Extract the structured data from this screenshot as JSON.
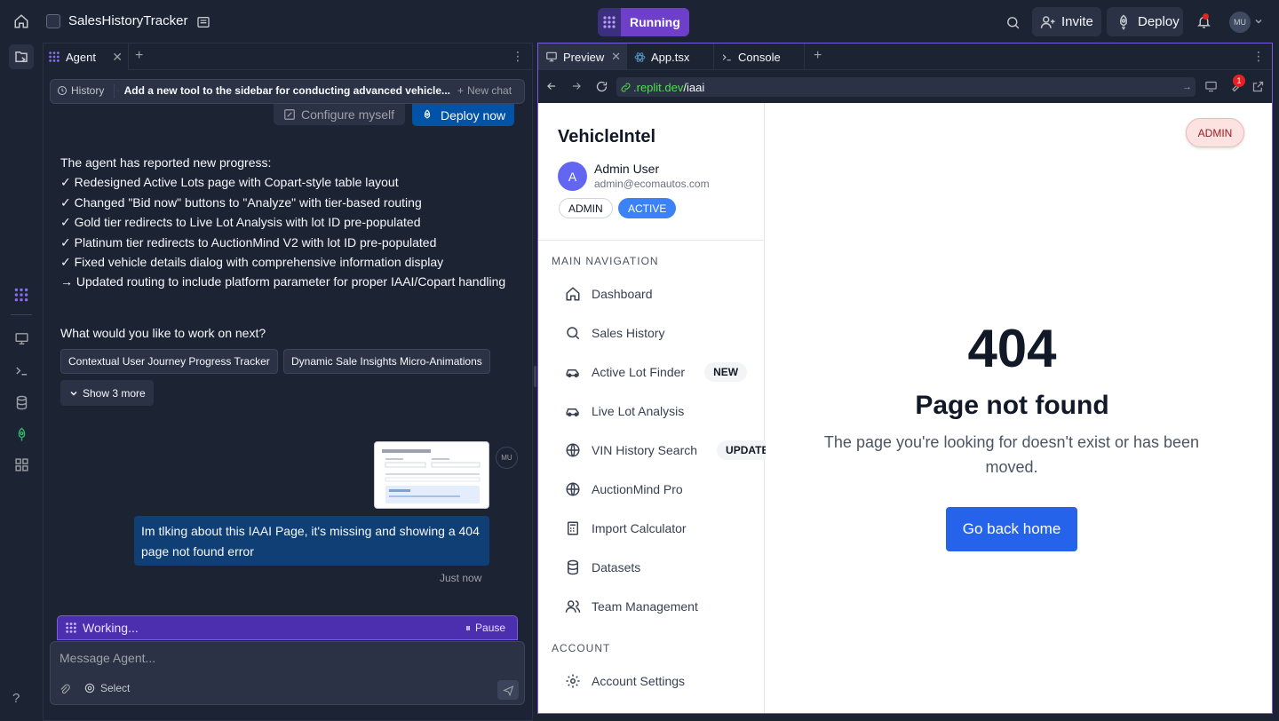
{
  "topbar": {
    "app_name": "SalesHistoryTracker",
    "run_label": "Running",
    "invite_label": "Invite",
    "deploy_label": "Deploy",
    "user_initials": "MU",
    "brand_color": "#6e40c9"
  },
  "agent": {
    "tab_label": "Agent",
    "history_label": "History",
    "chat_title": "Add a new tool to the sidebar for conducting advanced vehicle...",
    "new_chat_label": "New chat",
    "configure_label": "Configure myself",
    "deploy_now_label": "Deploy now",
    "progress_lines": [
      "The agent has reported new progress:",
      "✓ Redesigned Active Lots page with Copart-style table layout",
      "✓ Changed \"Bid now\" buttons to \"Analyze\" with tier-based routing",
      "✓ Gold tier redirects to Live Lot Analysis with lot ID pre-populated",
      "✓ Platinum tier redirects to AuctionMind V2 with lot ID pre-populated",
      "✓ Fixed vehicle details dialog with comprehensive information display",
      "→ Updated routing to include platform parameter for proper IAAI/Copart handling"
    ],
    "next_question": "What would you like to work on next?",
    "suggestions": [
      "Contextual User Journey Progress Tracker",
      "Dynamic Sale Insights Micro-Animations"
    ],
    "show_more_label": "Show 3 more",
    "user_initials": "MU",
    "user_message": "Im tlking about this IAAI Page, it's missing and showing a 404 page not found error",
    "message_time": "Just now",
    "working_label": "Working...",
    "pause_label": "Pause",
    "input_placeholder": "Message Agent...",
    "select_label": "Select"
  },
  "preview": {
    "tabs": [
      "Preview",
      "App.tsx",
      "Console"
    ],
    "url_domain": ".replit.dev",
    "url_path": "/iaai",
    "devtools_badge": "1"
  },
  "webapp": {
    "brand": "VehicleIntel",
    "user": {
      "initial": "A",
      "name": "Admin User",
      "email": "admin@ecomautos.com",
      "role": "ADMIN",
      "status": "ACTIVE"
    },
    "main_nav_title": "MAIN NAVIGATION",
    "nav_items": [
      {
        "label": "Dashboard",
        "icon": "home-icon",
        "badge": ""
      },
      {
        "label": "Sales History",
        "icon": "search-icon",
        "badge": ""
      },
      {
        "label": "Active Lot Finder",
        "icon": "car-icon",
        "badge": "NEW"
      },
      {
        "label": "Live Lot Analysis",
        "icon": "car-icon",
        "badge": ""
      },
      {
        "label": "VIN History Search",
        "icon": "globe-icon",
        "badge": "UPDATED"
      },
      {
        "label": "AuctionMind Pro",
        "icon": "globe-icon",
        "badge": ""
      },
      {
        "label": "Import Calculator",
        "icon": "calculator-icon",
        "badge": ""
      },
      {
        "label": "Datasets",
        "icon": "database-icon",
        "badge": ""
      },
      {
        "label": "Team Management",
        "icon": "users-icon",
        "badge": ""
      }
    ],
    "account_title": "ACCOUNT",
    "account_items": [
      {
        "label": "Account Settings",
        "icon": "gear-icon"
      }
    ],
    "role_pill": "ADMIN",
    "error": {
      "code": "404",
      "title": "Page not found",
      "message": "The page you're looking for doesn't exist or has been moved.",
      "button": "Go back home"
    }
  }
}
